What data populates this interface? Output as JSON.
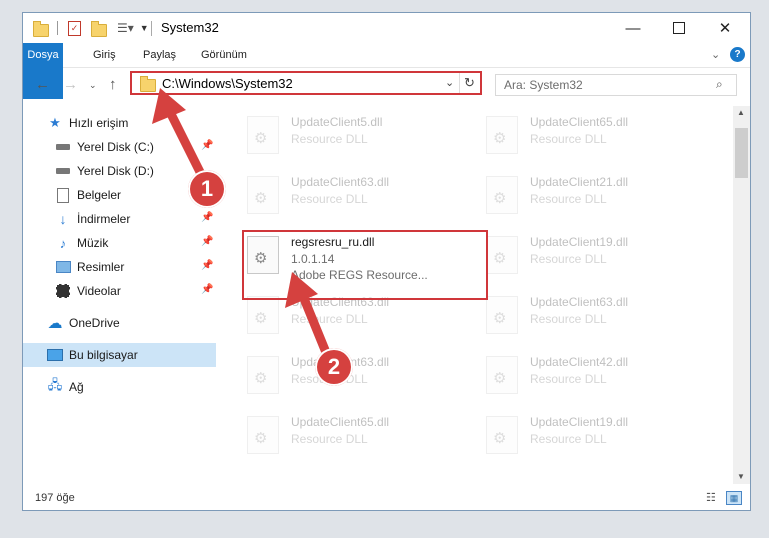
{
  "window": {
    "title": "System32"
  },
  "ribbon": {
    "tabs": [
      "Dosya",
      "Giriş",
      "Paylaş",
      "Görünüm"
    ]
  },
  "address": {
    "path": "C:\\Windows\\System32"
  },
  "search": {
    "placeholder": "Ara: System32"
  },
  "sidebar": {
    "items": [
      {
        "label": "Hızlı erişim"
      },
      {
        "label": "Yerel Disk (C:)"
      },
      {
        "label": "Yerel Disk (D:)"
      },
      {
        "label": "Belgeler"
      },
      {
        "label": "İndirmeler"
      },
      {
        "label": "Müzik"
      },
      {
        "label": "Resimler"
      },
      {
        "label": "Videolar"
      },
      {
        "label": "OneDrive"
      },
      {
        "label": "Bu bilgisayar"
      },
      {
        "label": "Ağ"
      }
    ]
  },
  "files": {
    "left": [
      {
        "name": "UpdateClient5.dll",
        "type": "Resource DLL"
      },
      {
        "name": "UpdateClient63.dll",
        "type": "Resource DLL"
      },
      {
        "name": "regsresru_ru.dll",
        "version": "1.0.1.14",
        "type": "Adobe REGS Resource..."
      },
      {
        "name": "UpdateClient63.dll",
        "type": "Resource DLL"
      },
      {
        "name": "UpdateClient63.dll",
        "type": "Resource DLL"
      },
      {
        "name": "UpdateClient65.dll",
        "type": "Resource DLL"
      }
    ],
    "right": [
      {
        "name": "UpdateClient65.dll",
        "type": "Resource DLL"
      },
      {
        "name": "UpdateClient21.dll",
        "type": "Resource DLL"
      },
      {
        "name": "UpdateClient19.dll",
        "type": "Resource DLL"
      },
      {
        "name": "UpdateClient63.dll",
        "type": "Resource DLL"
      },
      {
        "name": "UpdateClient42.dll",
        "type": "Resource DLL"
      },
      {
        "name": "UpdateClient19.dll",
        "type": "Resource DLL"
      }
    ]
  },
  "status": {
    "count": "197 öğe"
  },
  "annotations": {
    "step1": "1",
    "step2": "2",
    "color": "#d5413f"
  }
}
